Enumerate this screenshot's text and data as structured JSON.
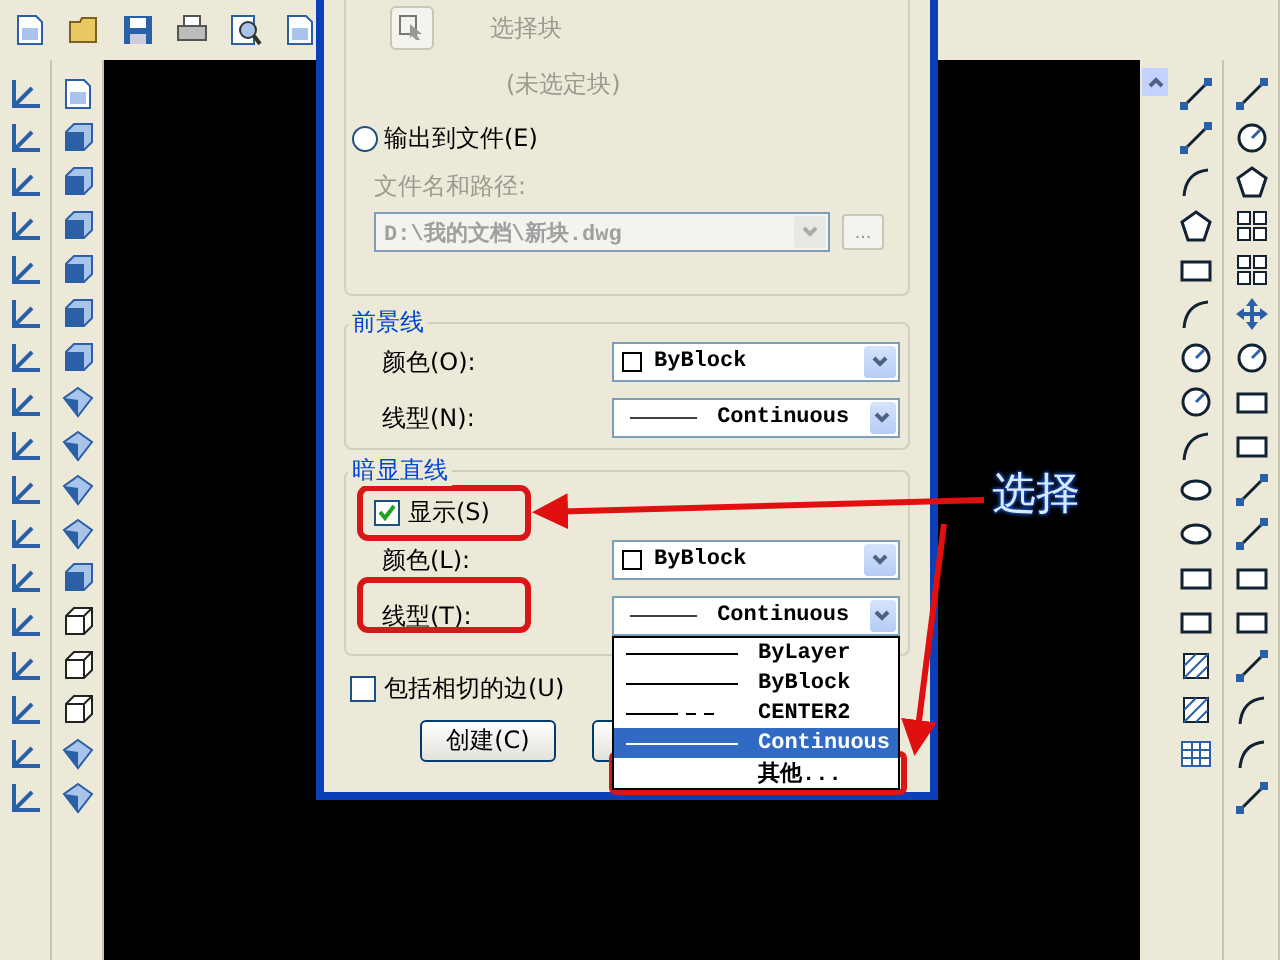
{
  "dialog": {
    "block_label": "选择块",
    "block_status": "(未选定块)",
    "output_file": {
      "label": "输出到文件(E)",
      "selected": false
    },
    "file_path_label": "文件名和路径:",
    "file_path": {
      "value": "D:\\我的文档\\新块.dwg",
      "disabled": true
    },
    "browse_button": "...",
    "foreground": {
      "title": "前景线",
      "color": {
        "label": "颜色(O):",
        "value": "ByBlock"
      },
      "linetype": {
        "label": "线型(N):",
        "value": "Continuous"
      }
    },
    "dimmed": {
      "title": "暗显直线",
      "show": {
        "label": "显示(S)",
        "checked": true
      },
      "color": {
        "label": "颜色(L):",
        "value": "ByBlock"
      },
      "linetype": {
        "label": "线型(T):",
        "value": "Continuous",
        "options": [
          {
            "label": "ByLayer",
            "kind": "solid",
            "selected": false
          },
          {
            "label": "ByBlock",
            "kind": "solid",
            "selected": false
          },
          {
            "label": "CENTER2",
            "kind": "dashed",
            "selected": false
          },
          {
            "label": "Continuous",
            "kind": "solid",
            "selected": true
          },
          {
            "label": "其他...",
            "kind": "none",
            "selected": false
          }
        ]
      }
    },
    "include_tangent": {
      "label": "包括相切的边(U)",
      "checked": false
    },
    "buttons": [
      "创建(C)"
    ]
  },
  "annotation": {
    "label": "选择"
  }
}
